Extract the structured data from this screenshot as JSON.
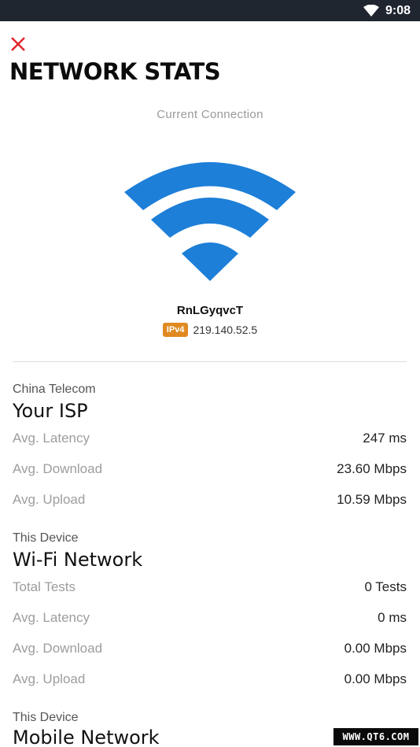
{
  "status_bar": {
    "time": "9:08",
    "wifi_icon": "wifi-icon"
  },
  "header": {
    "close_icon": "close-icon",
    "title": "NETWORK STATS"
  },
  "connection": {
    "label": "Current Connection",
    "ssid": "RnLGyqvcT",
    "ip_type": "IPv4",
    "ip_address": "219.140.52.5"
  },
  "isp": {
    "subtitle": "China Telecom",
    "title": "Your ISP",
    "rows": [
      {
        "label": "Avg. Latency",
        "value": "247 ms"
      },
      {
        "label": "Avg. Download",
        "value": "23.60 Mbps"
      },
      {
        "label": "Avg. Upload",
        "value": "10.59 Mbps"
      }
    ]
  },
  "wifi": {
    "subtitle": "This Device",
    "title": "Wi-Fi Network",
    "rows": [
      {
        "label": "Total Tests",
        "value": "0 Tests"
      },
      {
        "label": "Avg. Latency",
        "value": "0 ms"
      },
      {
        "label": "Avg. Download",
        "value": "0.00 Mbps"
      },
      {
        "label": "Avg. Upload",
        "value": "0.00 Mbps"
      }
    ]
  },
  "mobile": {
    "subtitle": "This Device",
    "title": "Mobile Network"
  },
  "watermark": "WWW.QT6.COM",
  "colors": {
    "accent_blue": "#1d7fd8",
    "close_red": "#e0262d",
    "ip_badge": "#e08a21"
  }
}
